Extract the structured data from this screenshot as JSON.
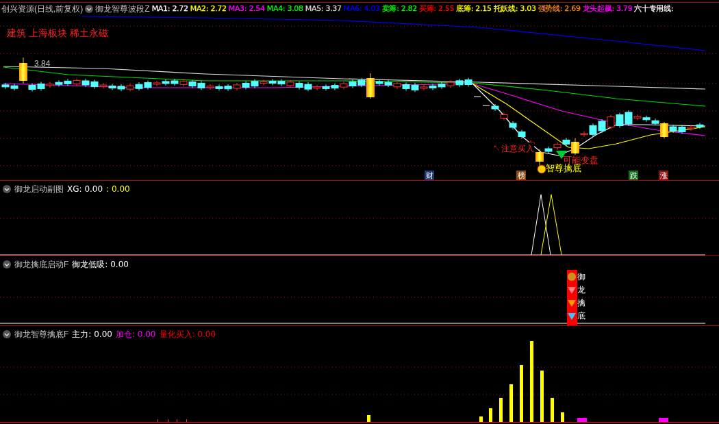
{
  "header": {
    "stock": "创兴资源(日线,前复权)",
    "indicator": "御龙智尊波段Z",
    "values": [
      {
        "label": "MA1: 2.72",
        "color": "#ffffff"
      },
      {
        "label": "MA2: 2.72",
        "color": "#ffff00"
      },
      {
        "label": "MA3: 2.54",
        "color": "#ff00ff"
      },
      {
        "label": "MA4: 3.08",
        "color": "#00ff00"
      },
      {
        "label": "MA5: 3.37",
        "color": "#dddddd"
      },
      {
        "label": "MA6: 4.03",
        "color": "#0000ff"
      },
      {
        "label": "卖筹: 2.82",
        "color": "#00ff00"
      },
      {
        "label": "买筹: 2.55",
        "color": "#ff0000"
      },
      {
        "label": "底筹: 2.15",
        "color": "#ffff00"
      },
      {
        "label": "托妖线: 3.03",
        "color": "#ffff00"
      },
      {
        "label": "强势线: 2.69",
        "color": "#ff8c00"
      },
      {
        "label": "龙头起飙: 3.79",
        "color": "#ff00ff"
      },
      {
        "label": "六十专用线:",
        "color": "#ffffff"
      }
    ]
  },
  "main": {
    "note": "建筑 上海板块 稀土永磁",
    "high_label": "3.84",
    "annotations": [
      "↖注意买入",
      "可能变盘",
      "智尊擒底"
    ],
    "tags": [
      {
        "text": "财",
        "color": "#203a78"
      },
      {
        "text": "榜",
        "color": "#8b4a14"
      },
      {
        "text": "跌",
        "color": "#13701a"
      },
      {
        "text": "涨",
        "color": "#8b1414"
      }
    ]
  },
  "panels": [
    {
      "title": "御龙启动副图",
      "values": [
        {
          "label": "XG: 0.00",
          "color": "#ffffff"
        },
        {
          "label": ": 0.00",
          "color": "#ffff00"
        }
      ]
    },
    {
      "title": "御龙擒底启动F",
      "values": [
        {
          "label": "御龙低吸: 0.00",
          "color": "#ffffff"
        }
      ],
      "signal": [
        "御",
        "龙",
        "擒",
        "底"
      ]
    },
    {
      "title": "御龙智尊擒底F",
      "values": [
        {
          "label": "主力: 0.00",
          "color": "#ffffff"
        },
        {
          "label": "加仓: 0.00",
          "color": "#ff00ff"
        },
        {
          "label": "量化买入: 0.00",
          "color": "#ff0000"
        }
      ]
    }
  ]
}
